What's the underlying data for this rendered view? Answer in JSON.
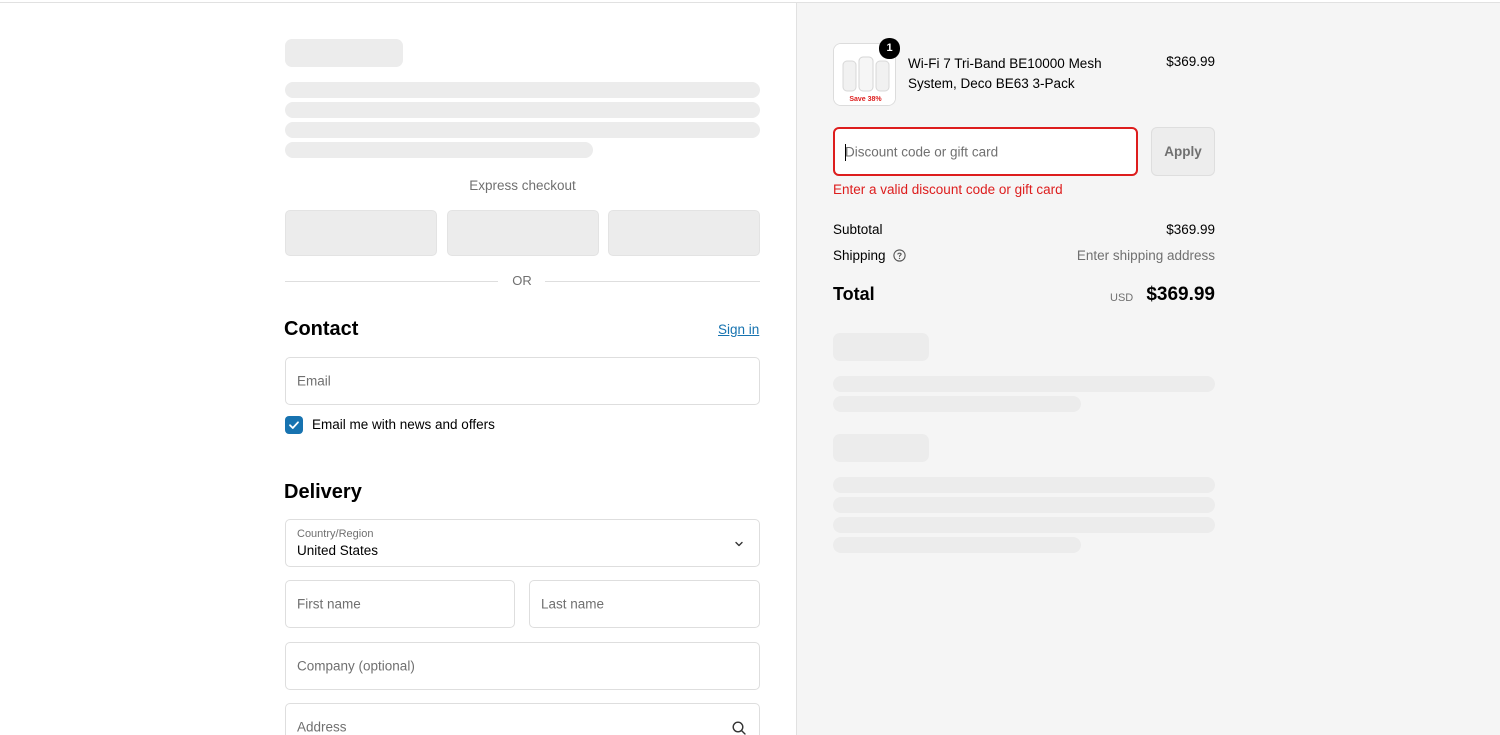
{
  "checkout": {
    "express_checkout_label": "Express checkout",
    "or_label": "OR",
    "contact": {
      "heading": "Contact",
      "sign_in_label": "Sign in",
      "email_placeholder": "Email",
      "newsletter_label": "Email me with news and offers",
      "newsletter_checked": true
    },
    "delivery": {
      "heading": "Delivery",
      "country_label": "Country/Region",
      "country_value": "United States",
      "first_name_placeholder": "First name",
      "last_name_placeholder": "Last name",
      "company_placeholder": "Company (optional)",
      "address_placeholder": "Address"
    }
  },
  "summary": {
    "product": {
      "name": "Wi-Fi 7 Tri-Band BE10000 Mesh System, Deco BE63 3-Pack",
      "price": "$369.99",
      "quantity": "1",
      "thumb_badge": "Save 38%"
    },
    "discount": {
      "placeholder": "Discount code or gift card",
      "apply_label": "Apply",
      "error": "Enter a valid discount code or gift card"
    },
    "subtotal_label": "Subtotal",
    "subtotal_value": "$369.99",
    "shipping_label": "Shipping",
    "shipping_value": "Enter shipping address",
    "total_label": "Total",
    "total_currency": "USD",
    "total_value": "$369.99"
  },
  "colors": {
    "accent": "#1773b0",
    "error": "#dd1d1d",
    "skeleton": "#ececec",
    "summary_bg": "#f5f5f5"
  },
  "icons": {
    "chevron": "chevron-down-icon",
    "help": "help-circle-icon",
    "search": "search-icon",
    "check": "check-icon"
  }
}
